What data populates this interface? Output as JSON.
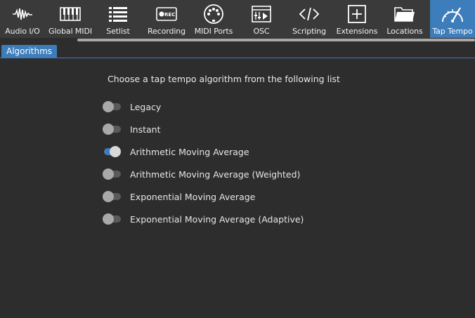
{
  "toolbar": {
    "items": [
      {
        "label": "Audio I/O",
        "icon": "waveform-icon"
      },
      {
        "label": "Global MIDI",
        "icon": "keyboard-icon"
      },
      {
        "label": "Setlist",
        "icon": "list-icon"
      },
      {
        "label": "Recording",
        "icon": "rec-icon"
      },
      {
        "label": "MIDI Ports",
        "icon": "midi-port-icon"
      },
      {
        "label": "OSC",
        "icon": "osc-icon"
      },
      {
        "label": "Scripting",
        "icon": "code-icon"
      },
      {
        "label": "Extensions",
        "icon": "plus-box-icon"
      },
      {
        "label": "Locations",
        "icon": "folder-icon"
      },
      {
        "label": "Tap Tempo",
        "icon": "gauge-icon",
        "active": true
      }
    ],
    "rec_badge": "REC"
  },
  "tabs": [
    {
      "label": "Algorithms",
      "active": true
    }
  ],
  "main": {
    "heading": "Choose a tap tempo algorithm from the following list",
    "options": [
      {
        "label": "Legacy",
        "selected": false
      },
      {
        "label": "Instant",
        "selected": false
      },
      {
        "label": "Arithmetic Moving Average",
        "selected": true
      },
      {
        "label": "Arithmetic Moving Average (Weighted)",
        "selected": false
      },
      {
        "label": "Exponential Moving Average",
        "selected": false
      },
      {
        "label": "Exponential Moving Average (Adaptive)",
        "selected": false
      }
    ]
  },
  "colors": {
    "accent": "#3d7dbb",
    "background": "#2d2d2d",
    "toolbar": "#3a3a3a"
  }
}
